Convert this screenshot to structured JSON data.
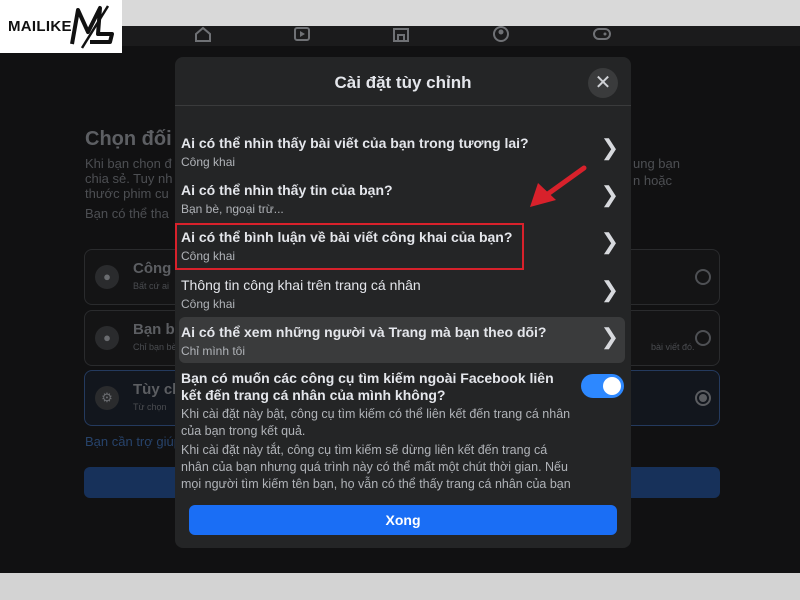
{
  "watermark": {
    "brand_name": "MAILIKE",
    "logo_text": "ML"
  },
  "nav_icons": [
    "home-icon",
    "video-icon",
    "marketplace-icon",
    "groups-icon",
    "gaming-icon"
  ],
  "background": {
    "heading": "Chọn đối",
    "text_lines": [
      "Khi bạn chọn đ",
      "chia sẻ. Tuy nh",
      "thước phim cu",
      "Bạn có thể tha"
    ],
    "text_right": [
      "ung bạn",
      "n hoặc"
    ],
    "options": [
      {
        "icon": "globe-icon",
        "label": "Công k",
        "sub": "Bất cứ ai",
        "sub_right": ""
      },
      {
        "icon": "friends-icon",
        "label": "Bạn bè",
        "sub": "Chỉ bạn bè",
        "sub_right": "bài viết đó."
      },
      {
        "icon": "gear-icon",
        "label": "Tùy ch",
        "sub": "Từ chọn",
        "sub_right": ""
      }
    ],
    "link": "Bạn cần trợ giúp"
  },
  "modal": {
    "title": "Cài đặt tùy chỉnh",
    "rows": [
      {
        "question": "Ai có thể nhìn thấy bài viết của bạn trong tương lai?",
        "answer": "Công khai"
      },
      {
        "question": "Ai có thể nhìn thấy tin của bạn?",
        "answer": "Bạn bè, ngoại trừ..."
      },
      {
        "question": "Ai có thể bình luận về bài viết công khai của bạn?",
        "answer": "Công khai"
      },
      {
        "question": "Thông tin công khai trên trang cá nhân",
        "answer": "Công khai"
      },
      {
        "question": "Ai có thể xem những người và Trang mà bạn theo dõi?",
        "answer": "Chỉ mình tôi"
      }
    ],
    "toggle": {
      "question": "Bạn có muốn các công cụ tìm kiếm ngoài Facebook liên kết đến trang cá nhân của mình không?",
      "enabled": true,
      "desc_on": "Khi cài đặt này bật, công cụ tìm kiếm có thể liên kết đến trang cá nhân của bạn trong kết quả.",
      "desc_off": "Khi cài đặt này tắt, công cụ tìm kiếm sẽ dừng liên kết đến trang cá nhân của bạn nhưng quá trình này có thể mất một chút thời gian. Nếu mọi người tìm kiếm tên bạn, họ vẫn có thể thấy trang cá nhân của bạn"
    },
    "done_label": "Xong"
  },
  "colors": {
    "accent": "#1a6ef5",
    "highlight": "#d8212b",
    "arrow": "#d8212b"
  }
}
